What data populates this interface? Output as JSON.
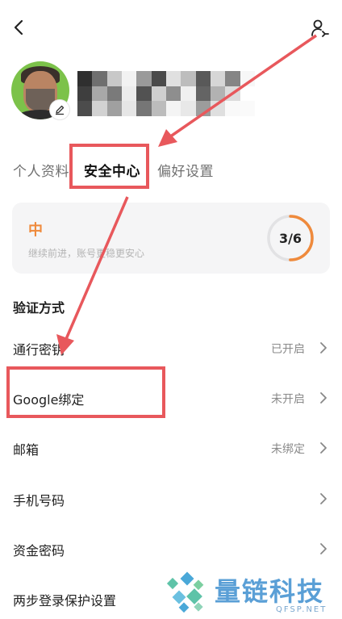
{
  "tabs": [
    {
      "label": "个人资料"
    },
    {
      "label": "安全中心"
    },
    {
      "label": "偏好设置"
    }
  ],
  "security_card": {
    "level": "中",
    "hint": "继续前进，账号更稳更安心",
    "score": "3/6",
    "progress": 0.5,
    "accent_color": "#ef8a3c"
  },
  "section_title": "验证方式",
  "rows": [
    {
      "label": "通行密钥",
      "status": "已开启"
    },
    {
      "label": "Google绑定",
      "status": "未开启"
    },
    {
      "label": "邮箱",
      "status": "未绑定"
    },
    {
      "label": "手机号码",
      "status": ""
    },
    {
      "label": "资金密码",
      "status": ""
    },
    {
      "label": "两步登录保护设置",
      "status": ""
    }
  ],
  "watermark": {
    "title": "量链科技",
    "subtitle": "QFSP.NET"
  },
  "icons": {
    "back": "back-icon",
    "user_settings": "user-settings-icon",
    "edit": "edit-icon",
    "chevron": "chevron-right-icon"
  },
  "annotation_color": "#e8585c"
}
